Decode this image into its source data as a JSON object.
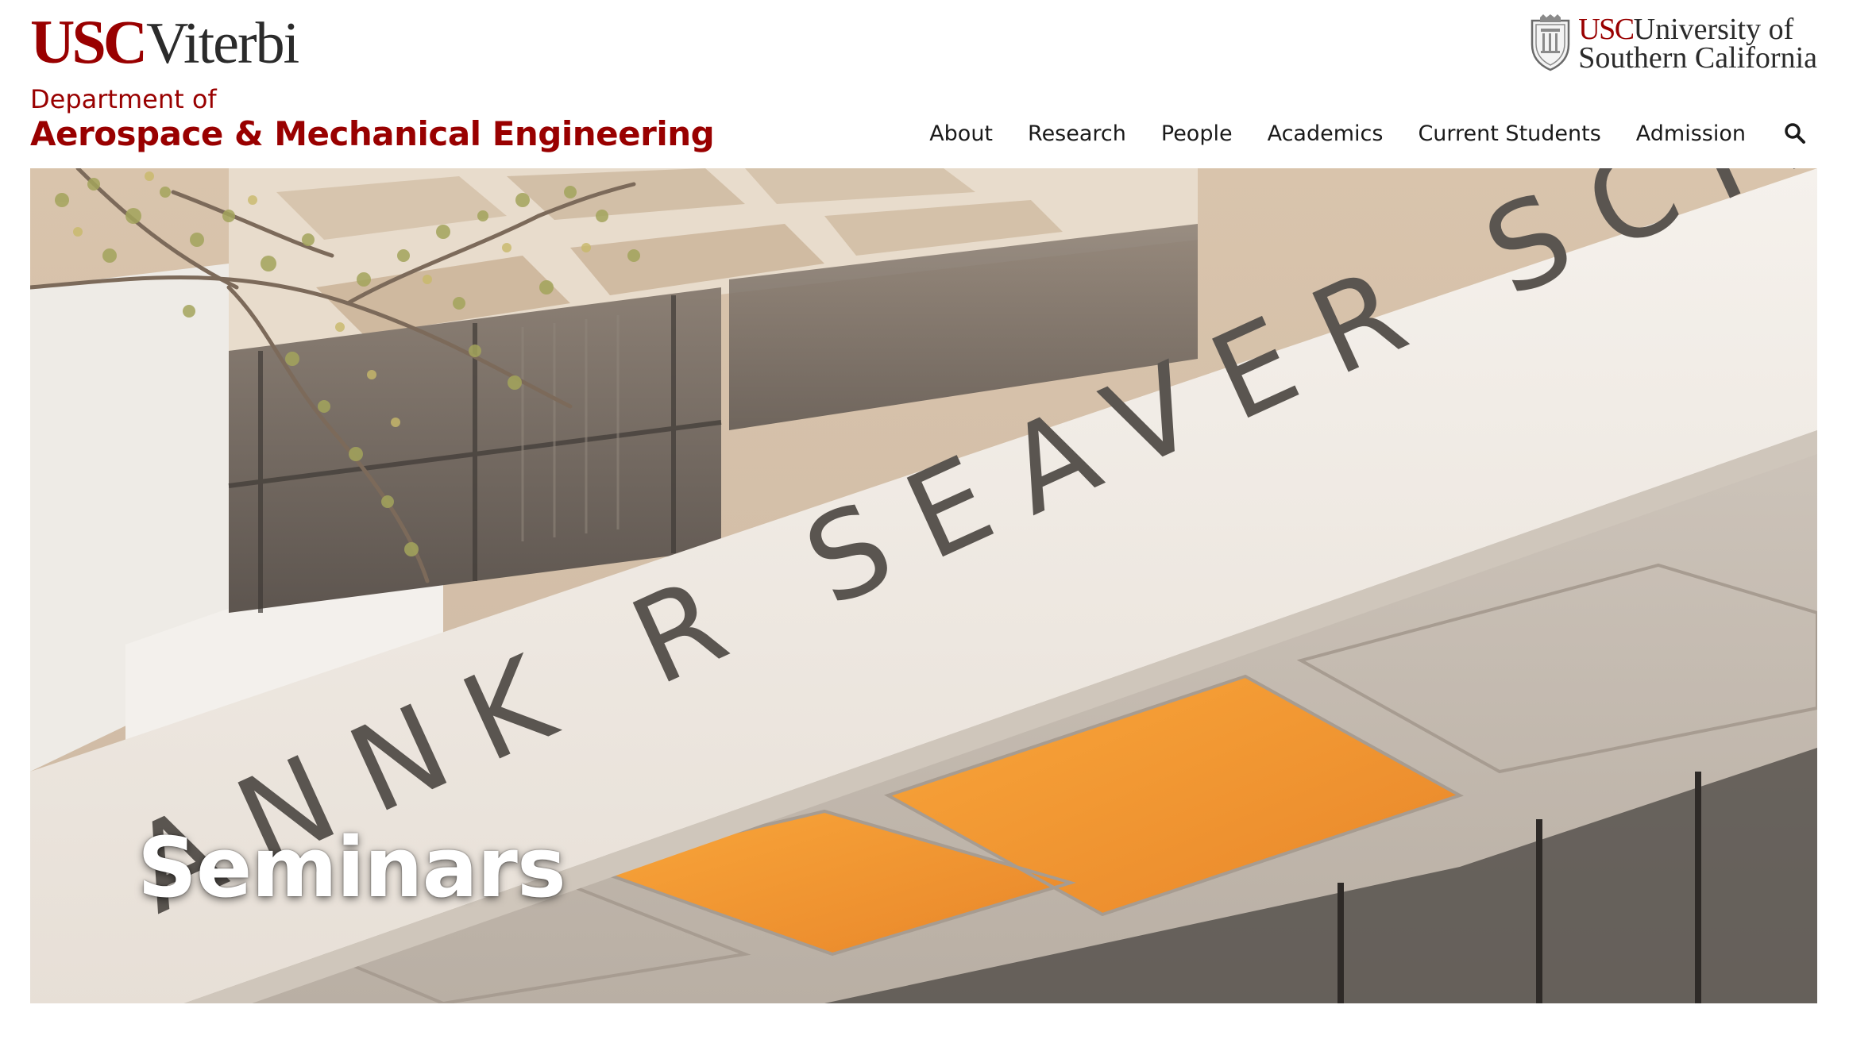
{
  "header": {
    "logo_usc": "USC",
    "logo_viterbi": "Viterbi",
    "department_line1": "Department of",
    "department_line2": "Aerospace & Mechanical Engineering",
    "university_usc": "USC",
    "university_line1_rest": "University of",
    "university_line2": "Southern California"
  },
  "nav": {
    "items": [
      "About",
      "Research",
      "People",
      "Academics",
      "Current Students",
      "Admission"
    ],
    "search_icon": "search-icon"
  },
  "hero": {
    "title": "Seminars",
    "sign_text": "ANNK R SEAVER SCIENCE CENTER"
  },
  "colors": {
    "brand": "#990000",
    "text": "#1a1a1a",
    "hero_title": "#ffffff"
  }
}
